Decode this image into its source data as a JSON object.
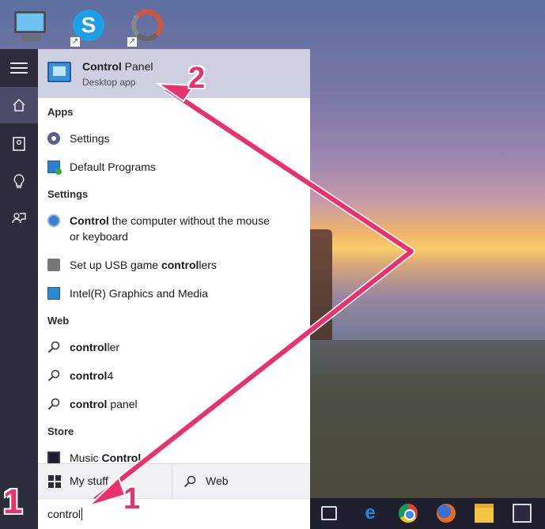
{
  "start_menu": {
    "top_result": {
      "title_bold": "Control",
      "title_rest": " Panel",
      "subtitle": "Desktop app"
    },
    "sections": [
      {
        "header": "Apps",
        "items": [
          {
            "icon": "settings-gear-icon",
            "bold": "",
            "rest": "Settings"
          },
          {
            "icon": "default-programs-icon",
            "bold": "",
            "rest": "Default Programs"
          }
        ]
      },
      {
        "header": "Settings",
        "items": [
          {
            "icon": "ease-of-access-icon",
            "bold": "Control",
            "rest": " the computer without the mouse",
            "line2": "or keyboard"
          },
          {
            "icon": "game-controller-icon",
            "pre": "Set up USB game ",
            "bold": "control",
            "rest": "lers"
          },
          {
            "icon": "intel-graphics-icon",
            "bold": "",
            "rest": "Intel(R) Graphics and Media"
          }
        ]
      },
      {
        "header": "Web",
        "items": [
          {
            "icon": "search-icon",
            "bold": "control",
            "rest": "ler"
          },
          {
            "icon": "search-icon",
            "bold": "control",
            "rest": "4"
          },
          {
            "icon": "search-icon",
            "bold": "control",
            "rest": " panel"
          }
        ]
      },
      {
        "header": "Store",
        "items": [
          {
            "icon": "store-app-icon",
            "pre": "Music ",
            "bold": "Control",
            "rest": ""
          }
        ]
      }
    ],
    "tabs": {
      "my_stuff": "My stuff",
      "web": "Web"
    },
    "search": {
      "value": "control"
    }
  },
  "annotations": {
    "step1": "1",
    "step1_small": "1",
    "step2": "2",
    "color": "#e8326e"
  },
  "colors": {
    "rail": "#2b2d3a",
    "top_result": "#cfcfe2",
    "taskbar": "#1f1f2d"
  }
}
